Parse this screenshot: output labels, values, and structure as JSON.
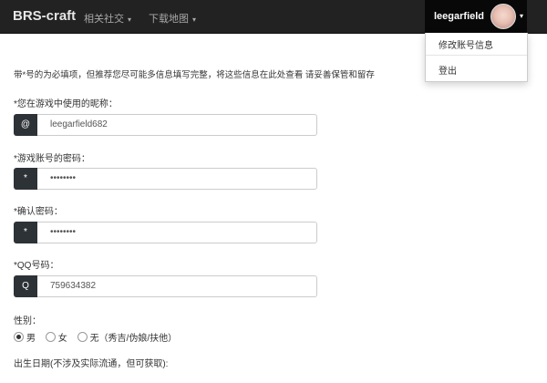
{
  "navbar": {
    "brand": "BRS-craft",
    "menus": [
      {
        "label": "相关社交"
      },
      {
        "label": "下载地图"
      }
    ],
    "caret": "▾"
  },
  "user": {
    "name": "leegarfield",
    "menu_items": [
      {
        "label": "修改账号信息"
      },
      {
        "label": "登出"
      }
    ]
  },
  "form": {
    "notice": "带*号的为必填项，但推荐您尽可能多信息填写完整，将这些信息在此处查看 请妥善保管和留存",
    "fields": [
      {
        "label": "*您在游戏中使用的昵称：",
        "addon": "@",
        "value": "leegarfield682"
      },
      {
        "label": "*游戏账号的密码：",
        "addon": "*",
        "value": "••••••••"
      },
      {
        "label": "*确认密码：",
        "addon": "*",
        "value": "••••••••"
      },
      {
        "label": "*QQ号码：",
        "addon": "Q",
        "value": "759634382"
      }
    ],
    "gender": {
      "label": "性别：",
      "options": [
        {
          "label": "男",
          "checked": true
        },
        {
          "label": "女",
          "checked": false
        },
        {
          "label": "无（秀吉/伪娘/扶他）",
          "checked": false
        }
      ]
    },
    "birthday_label": "出生日期(不涉及实际流通，但可获取):"
  }
}
